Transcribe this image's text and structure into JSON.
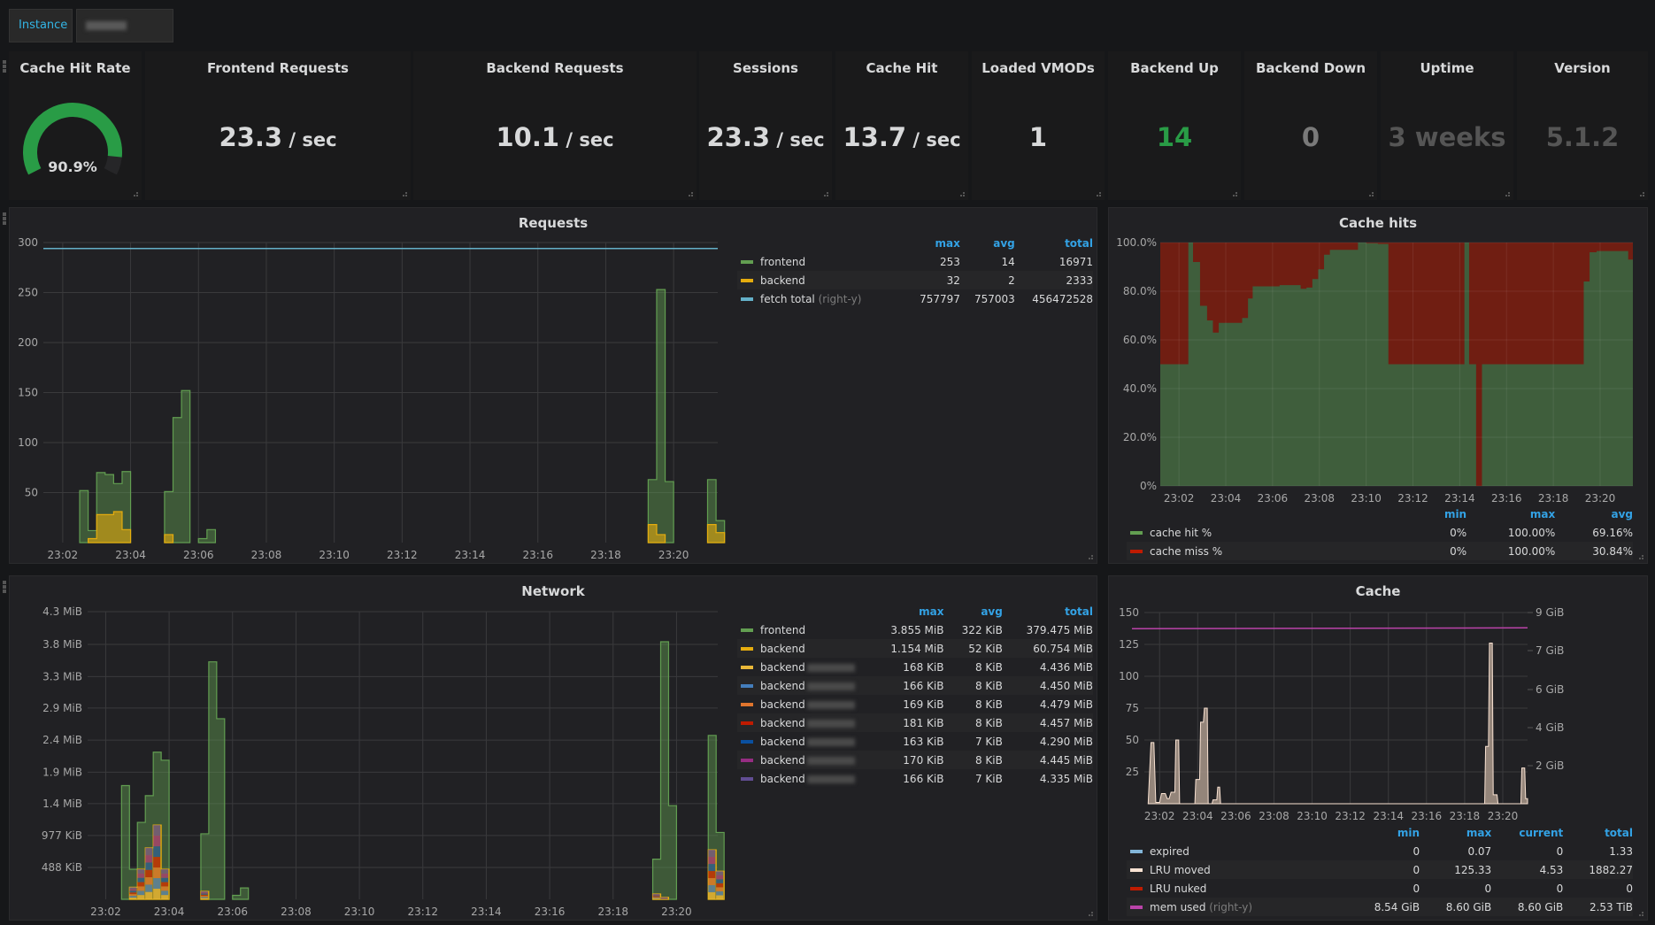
{
  "toolbar": {
    "instance_label": "Instance",
    "instance_value_suffix": ".43.29",
    "instance_value_redacted": true
  },
  "stats": [
    {
      "title": "Cache Hit Rate",
      "type": "gauge",
      "value": 90.9,
      "display": "90.9%",
      "color": "#299c46"
    },
    {
      "title": "Frontend Requests",
      "value": "23.3",
      "unit": " / sec",
      "color": "#d8d9da"
    },
    {
      "title": "Backend Requests",
      "value": "10.1",
      "unit": " / sec",
      "color": "#d8d9da"
    },
    {
      "title": "Sessions",
      "value": "23.3",
      "unit": " / sec",
      "color": "#d8d9da"
    },
    {
      "title": "Cache Hit",
      "value": "13.7",
      "unit": " / sec",
      "color": "#d8d9da"
    },
    {
      "title": "Loaded VMODs",
      "value": "1",
      "unit": "",
      "color": "#d8d9da"
    },
    {
      "title": "Backend Up",
      "value": "14",
      "unit": "",
      "color": "#299c46"
    },
    {
      "title": "Backend Down",
      "value": "0",
      "unit": "",
      "color": "#7a7a7a"
    },
    {
      "title": "Uptime",
      "value": "3 weeks",
      "unit": "",
      "color": "#555555"
    },
    {
      "title": "Version",
      "value": "5.1.2",
      "unit": "",
      "color": "#555555"
    }
  ],
  "chart_data": [
    {
      "id": "requests",
      "type": "area",
      "title": "Requests",
      "x_ticks": [
        "23:02",
        "23:04",
        "23:06",
        "23:08",
        "23:10",
        "23:12",
        "23:14",
        "23:16",
        "23:18",
        "23:20"
      ],
      "x_range_min": [
        1.0,
        21.3
      ],
      "y_ticks": [
        50,
        100,
        150,
        200,
        250,
        300
      ],
      "ylim": [
        0,
        300
      ],
      "step_min": 0.25,
      "series": [
        {
          "name": "frontend",
          "color": "#629e51",
          "points": [
            [
              2.5,
              52
            ],
            [
              2.75,
              12
            ],
            [
              3.0,
              70
            ],
            [
              3.25,
              68
            ],
            [
              3.5,
              59
            ],
            [
              3.75,
              71
            ],
            [
              4.0,
              0
            ],
            [
              5.0,
              51
            ],
            [
              5.25,
              125
            ],
            [
              5.5,
              152
            ],
            [
              5.75,
              0
            ],
            [
              6.0,
              4
            ],
            [
              6.25,
              13
            ],
            [
              6.5,
              0
            ],
            [
              19.25,
              63
            ],
            [
              19.5,
              253
            ],
            [
              19.75,
              61
            ],
            [
              20.0,
              0
            ],
            [
              21.0,
              63
            ],
            [
              21.25,
              22
            ]
          ]
        },
        {
          "name": "backend",
          "color": "#e5ac0e",
          "points": [
            [
              2.75,
              4
            ],
            [
              3.0,
              28
            ],
            [
              3.25,
              28
            ],
            [
              3.5,
              31
            ],
            [
              3.75,
              13
            ],
            [
              4.0,
              0
            ],
            [
              5.0,
              8
            ],
            [
              5.25,
              0
            ],
            [
              19.25,
              18
            ],
            [
              19.5,
              8
            ],
            [
              19.75,
              0
            ],
            [
              21.0,
              18
            ],
            [
              21.25,
              10
            ]
          ]
        }
      ],
      "right_series": {
        "name": "fetch total",
        "color": "#64b0c8",
        "level": 294
      },
      "legend": {
        "columns": [
          "max",
          "avg",
          "total"
        ],
        "rows": [
          {
            "name": "frontend",
            "color": "#629e51",
            "suffix": "",
            "values": [
              "253",
              "14",
              "16971"
            ]
          },
          {
            "name": "backend",
            "color": "#e5ac0e",
            "suffix": "",
            "values": [
              "32",
              "2",
              "2333"
            ]
          },
          {
            "name": "fetch total",
            "color": "#64b0c8",
            "suffix": "(right-y)",
            "values": [
              "757797",
              "757003",
              "456472528"
            ]
          }
        ]
      }
    },
    {
      "id": "cache_hits",
      "type": "area",
      "title": "Cache hits",
      "x_ticks": [
        "23:02",
        "23:04",
        "23:06",
        "23:08",
        "23:10",
        "23:12",
        "23:14",
        "23:16",
        "23:18",
        "23:20"
      ],
      "x_range_min": [
        1.2,
        21.4
      ],
      "y_ticks": [
        "0%",
        "20.0%",
        "40.0%",
        "60.0%",
        "80.0%",
        "100.0%"
      ],
      "ylim": [
        0,
        100
      ],
      "hit_points": [
        [
          1.2,
          50
        ],
        [
          2.4,
          100
        ],
        [
          2.6,
          92
        ],
        [
          2.9,
          74
        ],
        [
          3.2,
          68
        ],
        [
          3.45,
          63
        ],
        [
          3.7,
          67
        ],
        [
          4.7,
          69
        ],
        [
          4.95,
          77
        ],
        [
          5.15,
          82
        ],
        [
          6.0,
          82
        ],
        [
          6.3,
          82.5
        ],
        [
          7.2,
          81
        ],
        [
          7.45,
          81.5
        ],
        [
          7.7,
          85
        ],
        [
          7.95,
          89
        ],
        [
          8.2,
          95
        ],
        [
          8.45,
          97
        ],
        [
          9.65,
          100
        ],
        [
          10.0,
          99.7
        ],
        [
          10.5,
          99.4
        ],
        [
          10.95,
          50
        ],
        [
          14.2,
          100
        ],
        [
          14.4,
          50
        ],
        [
          14.7,
          0
        ],
        [
          14.95,
          50
        ],
        [
          19.3,
          84
        ],
        [
          19.55,
          96
        ],
        [
          19.85,
          96.5
        ],
        [
          20.95,
          96.5
        ],
        [
          21.2,
          93
        ],
        [
          21.4,
          91
        ]
      ],
      "series_names": [
        "cache hit %",
        "cache miss %"
      ],
      "colors": {
        "hit": "#629e51",
        "miss": "#bf1b00"
      },
      "legend": {
        "columns": [
          "min",
          "max",
          "avg"
        ],
        "rows": [
          {
            "name": "cache hit %",
            "color": "#629e51",
            "values": [
              "0%",
              "100.00%",
              "69.16%"
            ]
          },
          {
            "name": "cache miss %",
            "color": "#bf1b00",
            "values": [
              "0%",
              "100.00%",
              "30.84%"
            ]
          }
        ]
      }
    },
    {
      "id": "network",
      "type": "area",
      "title": "Network",
      "x_ticks": [
        "23:02",
        "23:04",
        "23:06",
        "23:08",
        "23:10",
        "23:12",
        "23:14",
        "23:16",
        "23:18",
        "23:20"
      ],
      "x_range_min": [
        0.0,
        21.3
      ],
      "y_ticks": [
        "488 KiB",
        "977 KiB",
        "1.4 MiB",
        "1.9 MiB",
        "2.4 MiB",
        "2.9 MiB",
        "3.3 MiB",
        "3.8 MiB",
        "4.3 MiB"
      ],
      "ylim_mib": [
        0,
        4.3
      ],
      "step_min": 0.25,
      "series": [
        {
          "name": "frontend",
          "color": "#629e51",
          "points": [
            [
              2.5,
              1.7
            ],
            [
              2.75,
              0.45
            ],
            [
              3.0,
              1.15
            ],
            [
              3.25,
              1.55
            ],
            [
              3.5,
              2.2
            ],
            [
              3.75,
              2.08
            ],
            [
              4.0,
              0
            ],
            [
              5.0,
              0.98
            ],
            [
              5.25,
              3.55
            ],
            [
              5.5,
              2.7
            ],
            [
              5.75,
              0
            ],
            [
              6.0,
              0.06
            ],
            [
              6.25,
              0.17
            ],
            [
              6.5,
              0
            ],
            [
              19.25,
              0.6
            ],
            [
              19.5,
              3.85
            ],
            [
              19.75,
              1.4
            ],
            [
              20.0,
              0
            ],
            [
              21.0,
              2.45
            ],
            [
              21.25,
              1.0
            ]
          ]
        },
        {
          "name": "backend",
          "color": "#e5ac0e",
          "points": [
            [
              2.75,
              0.18
            ],
            [
              3.0,
              0.45
            ],
            [
              3.25,
              0.77
            ],
            [
              3.5,
              1.11
            ],
            [
              3.75,
              0.45
            ],
            [
              4.0,
              0
            ],
            [
              5.0,
              0.12
            ],
            [
              5.25,
              0
            ],
            [
              19.25,
              0.08
            ],
            [
              19.5,
              0.03
            ],
            [
              19.75,
              0
            ],
            [
              21.0,
              0.74
            ],
            [
              21.25,
              0.42
            ]
          ]
        }
      ],
      "legend": {
        "columns": [
          "max",
          "avg",
          "total"
        ],
        "rows": [
          {
            "name": "frontend",
            "color": "#629e51",
            "redacted": false,
            "values": [
              "3.855 MiB",
              "322 KiB",
              "379.475 MiB"
            ]
          },
          {
            "name": "backend",
            "color": "#e5ac0e",
            "redacted": false,
            "values": [
              "1.154 MiB",
              "52 KiB",
              "60.754 MiB"
            ]
          },
          {
            "name": "backend",
            "color": "#eab839",
            "redacted": true,
            "values": [
              "168 KiB",
              "8 KiB",
              "4.436 MiB"
            ]
          },
          {
            "name": "backend",
            "color": "#447ebc",
            "redacted": true,
            "values": [
              "166 KiB",
              "8 KiB",
              "4.450 MiB"
            ]
          },
          {
            "name": "backend",
            "color": "#e0752d",
            "redacted": true,
            "values": [
              "169 KiB",
              "8 KiB",
              "4.479 MiB"
            ]
          },
          {
            "name": "backend",
            "color": "#bf1b00",
            "redacted": true,
            "values": [
              "181 KiB",
              "8 KiB",
              "4.457 MiB"
            ]
          },
          {
            "name": "backend",
            "color": "#0a50a1",
            "redacted": true,
            "values": [
              "163 KiB",
              "7 KiB",
              "4.290 MiB"
            ]
          },
          {
            "name": "backend",
            "color": "#962d82",
            "redacted": true,
            "values": [
              "170 KiB",
              "8 KiB",
              "4.445 MiB"
            ]
          },
          {
            "name": "backend",
            "color": "#614d93",
            "redacted": true,
            "values": [
              "166 KiB",
              "7 KiB",
              "4.335 MiB"
            ]
          }
        ]
      }
    },
    {
      "id": "cache",
      "type": "area",
      "title": "Cache",
      "x_ticks": [
        "23:02",
        "23:04",
        "23:06",
        "23:08",
        "23:10",
        "23:12",
        "23:14",
        "23:16",
        "23:18",
        "23:20"
      ],
      "x_range_min": [
        1.2,
        21.3
      ],
      "y_ticks": [
        25,
        50,
        75,
        100,
        125,
        150
      ],
      "ylim": [
        0,
        150
      ],
      "y2_ticks": [
        "2 GiB",
        "4 GiB",
        "6 GiB",
        "7 GiB",
        "9 GiB"
      ],
      "y2_values_gib": [
        1.8,
        3.8,
        5.8,
        7.8,
        9.7
      ],
      "series": [
        {
          "name": "LRU moved",
          "color": "#f9e2d2",
          "points": [
            [
              1.4,
              0
            ],
            [
              1.55,
              48
            ],
            [
              1.7,
              48
            ],
            [
              1.8,
              1
            ],
            [
              2.0,
              1
            ],
            [
              2.1,
              8
            ],
            [
              2.3,
              8
            ],
            [
              2.4,
              4
            ],
            [
              2.5,
              4
            ],
            [
              2.6,
              9
            ],
            [
              2.8,
              9
            ],
            [
              2.85,
              50
            ],
            [
              3.0,
              50
            ],
            [
              3.05,
              0
            ],
            [
              3.85,
              0
            ],
            [
              3.9,
              19
            ],
            [
              4.1,
              19
            ],
            [
              4.15,
              64
            ],
            [
              4.3,
              64
            ],
            [
              4.35,
              75
            ],
            [
              4.5,
              75
            ],
            [
              4.55,
              0
            ],
            [
              4.75,
              0
            ],
            [
              4.8,
              3
            ],
            [
              5.0,
              3
            ],
            [
              5.05,
              13
            ],
            [
              5.15,
              13
            ],
            [
              5.2,
              0
            ],
            [
              19.05,
              0
            ],
            [
              19.1,
              45
            ],
            [
              19.25,
              45
            ],
            [
              19.3,
              126
            ],
            [
              19.45,
              126
            ],
            [
              19.5,
              7
            ],
            [
              19.7,
              7
            ],
            [
              19.75,
              0
            ],
            [
              20.95,
              0
            ],
            [
              21.0,
              28
            ],
            [
              21.15,
              28
            ],
            [
              21.2,
              4
            ],
            [
              21.3,
              4
            ]
          ]
        }
      ],
      "mem_used_level": 138,
      "legend": {
        "columns": [
          "min",
          "max",
          "current",
          "total"
        ],
        "rows": [
          {
            "name": "expired",
            "color": "#82b5d8",
            "suffix": "",
            "values": [
              "0",
              "0.07",
              "0",
              "1.33"
            ]
          },
          {
            "name": "LRU moved",
            "color": "#f9e2d2",
            "suffix": "",
            "values": [
              "0",
              "125.33",
              "4.53",
              "1882.27"
            ]
          },
          {
            "name": "LRU nuked",
            "color": "#bf1b00",
            "suffix": "",
            "values": [
              "0",
              "0",
              "0",
              "0"
            ]
          },
          {
            "name": "mem used",
            "color": "#ba43a9",
            "suffix": "(right-y)",
            "values": [
              "8.54 GiB",
              "8.60 GiB",
              "8.60 GiB",
              "2.53 TiB"
            ]
          }
        ]
      }
    }
  ]
}
